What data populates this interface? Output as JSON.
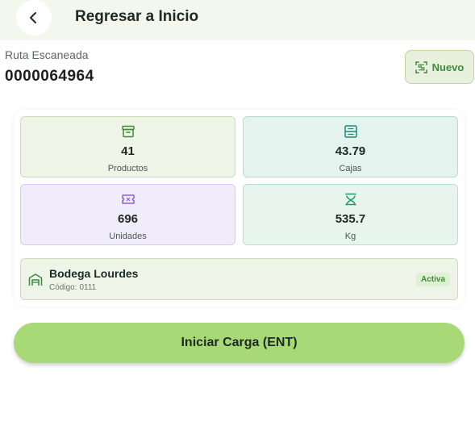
{
  "header": {
    "title": "Regresar a Inicio",
    "back_icon": "chevron-left-icon"
  },
  "route": {
    "label": "Ruta Escaneada",
    "value": "0000064964",
    "new_button_label": "Nuevo",
    "new_button_icon": "scan-qr-icon"
  },
  "stats": [
    {
      "value": "41",
      "label": "Productos",
      "icon": "archive-box-icon",
      "color": "#3f8a3b"
    },
    {
      "value": "43.79",
      "label": "Cajas",
      "icon": "boxes-icon",
      "color": "#1f8a7a"
    },
    {
      "value": "696",
      "label": "Unidades",
      "icon": "ticket-icon",
      "color": "#8a63d2"
    },
    {
      "value": "535.7",
      "label": "Kg",
      "icon": "scale-icon",
      "color": "#1f9a62"
    }
  ],
  "warehouse": {
    "name": "Bodega Lourdes",
    "code_label": "Código:",
    "code": "0111",
    "status": "Activa",
    "icon": "warehouse-icon"
  },
  "action": {
    "label": "Iniciar Carga (ENT)"
  },
  "colors": {
    "accent": "#a8d977",
    "brand_green": "#3f8a3b"
  }
}
